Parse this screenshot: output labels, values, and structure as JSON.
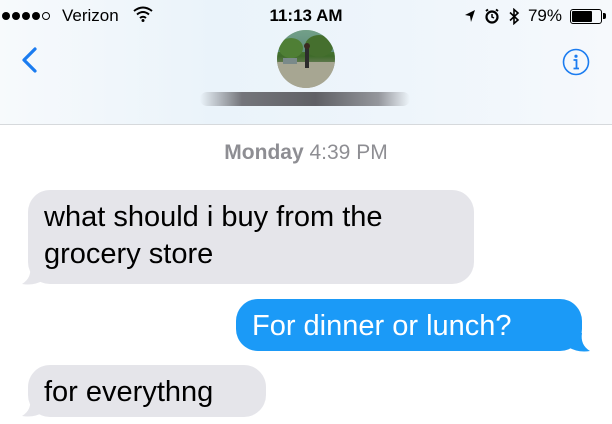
{
  "status_bar": {
    "carrier": "Verizon",
    "time": "11:13 AM",
    "battery_percent": "79%",
    "battery_level": 0.79,
    "signal_bars_filled": 4,
    "signal_bars_total": 5
  },
  "header": {
    "back_icon": "chevron-left-icon",
    "info_icon": "info-icon",
    "accent_color": "#1b7cf0"
  },
  "conversation": {
    "timestamp_day": "Monday",
    "timestamp_time": "4:39 PM",
    "messages": [
      {
        "direction": "incoming",
        "lines": [
          "what should i buy from the",
          "grocery store"
        ]
      },
      {
        "direction": "outgoing",
        "lines": [
          "For dinner or lunch?"
        ]
      },
      {
        "direction": "incoming",
        "lines": [
          "for everythng"
        ]
      }
    ],
    "incoming_color": "#e5e5ea",
    "outgoing_color": "#1b9af7"
  }
}
